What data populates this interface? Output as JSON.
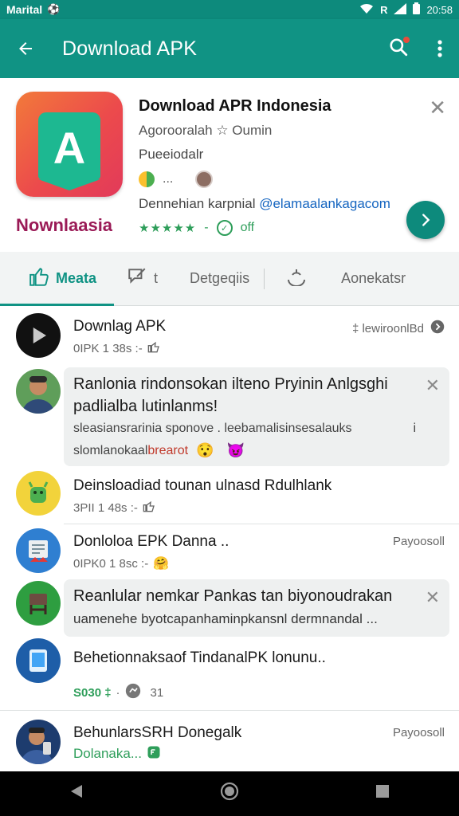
{
  "status_bar": {
    "carrier": "Marital",
    "time": "20:58"
  },
  "app_bar": {
    "title": "Download APK"
  },
  "app_card": {
    "logo_letter": "A",
    "brand_text": "Nownlaasia",
    "name": "Download APR Indonesia",
    "developer": "Agorooralah ☆ Oumin",
    "subtitle": "Pueeiodalr",
    "chip_more": "...",
    "description": "Dennehian karpnial ",
    "link": "@elamaalankagacom",
    "rating_stars": "★★★★★",
    "rating_suffix": "off"
  },
  "tabs": [
    {
      "label": "Meata"
    },
    {
      "label": "t"
    },
    {
      "label": "Detgeqiis"
    },
    {
      "label": "Aonekatsr"
    }
  ],
  "list": {
    "item1": {
      "title": "Downlag APK",
      "meta": "0IPK 1 38s :-",
      "right": "‡ lewiroonlBd"
    },
    "item2": {
      "title_line1": "Ranlonia rindonsokan ilteno Pryinin Anlgsghi",
      "title_line2": "padlialba lutinlanms!",
      "body_line1": "sleasiansrarinia sponove . leebamalisinsesalauks",
      "body_mark": "i",
      "body_line2_prefix": "slomlanokaal ",
      "body_line2_highlight": "brearot"
    },
    "item3": {
      "title": "Deinsloadiad tounan ulnasd Rdulhlank",
      "meta": "3PII 1 48s :-"
    },
    "item4": {
      "title": "Donloloa EPK Danna ..",
      "meta": "0IPK0 1 8sc :-",
      "right": "Payoosoll"
    },
    "item5": {
      "title_line1": "Reanlular nemkar Pankas tan biyonoudrakan",
      "title_line2": "uamenehe byotcapanhaminpkansnl dermnandal ..."
    },
    "item6": {
      "title": "Behetionnaksaof TindanalPK lonunu..",
      "meta_green": "S030 ‡",
      "meta_sep": "·",
      "meta_count": "31"
    },
    "item7": {
      "title": "BehunlarsSRH Donegalk",
      "meta_green": "Dolanaka...",
      "right": "Payoosoll"
    }
  },
  "colors": {
    "primary": "#109384",
    "brand_text": "#9a1a56",
    "accent_green": "#2e9e5a",
    "highlight_red": "#c0392b"
  }
}
